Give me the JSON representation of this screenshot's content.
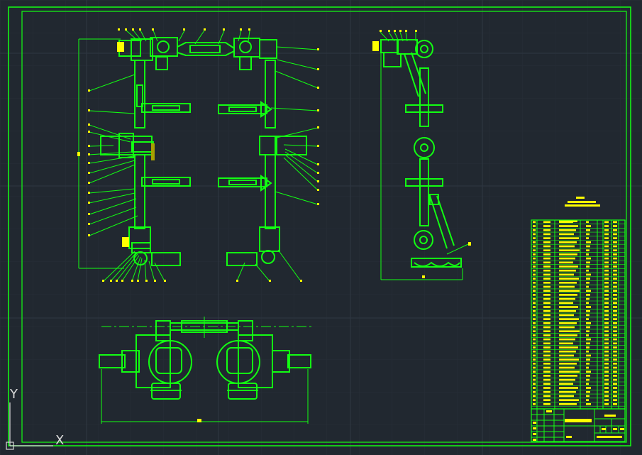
{
  "app": {
    "canvas_background": "#212830",
    "grid_color": "#2b333d",
    "line_color": "#12ff12",
    "text_color": "#ffff00",
    "frame_color": "#12ff12"
  },
  "ucs": {
    "y_label": "Y",
    "x_label": "X",
    "icon": "ucs-icon"
  },
  "drawing": {
    "views": [
      "front-view",
      "side-view",
      "top-view"
    ],
    "title_block": "title-block",
    "parts_list": "parts-list"
  }
}
